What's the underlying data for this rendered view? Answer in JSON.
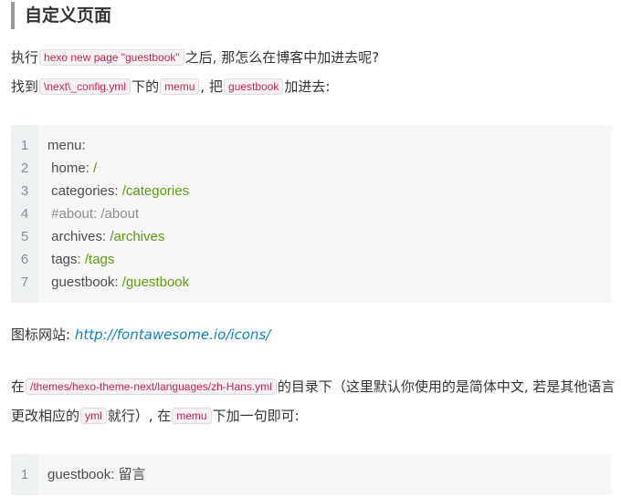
{
  "heading": "自定义页面",
  "p1": {
    "t1": "执行",
    "code1": "hexo new page \"guestbook\"",
    "t2": "之后, 那怎么在博客中加进去呢?"
  },
  "p2": {
    "t1": "找到",
    "code1": "\\next\\_config.yml",
    "t2": "下的",
    "code2": "memu",
    "t3": ", 把",
    "code3": "guestbook",
    "t4": "加进去:"
  },
  "code_block_1": {
    "line_numbers": [
      "1",
      "2",
      "3",
      "4",
      "5",
      "6",
      "7"
    ],
    "lines": [
      {
        "key": "menu:",
        "value": ""
      },
      {
        "key": " home: ",
        "value": "/"
      },
      {
        "key": " categories: ",
        "value": "/categories"
      },
      {
        "comment": " #about: /about"
      },
      {
        "key": " archives: ",
        "value": "/archives"
      },
      {
        "key": " tags: ",
        "value": "/tags"
      },
      {
        "key": " guestbook: ",
        "value": "/guestbook"
      }
    ]
  },
  "p3": {
    "label": "图标网站: ",
    "link": "http://fontawesome.io/icons/"
  },
  "p4": {
    "t1": "在",
    "code1": "/themes/hexo-theme-next/languages/zh-Hans.yml",
    "t2": "的目录下（这里默认你使用的是简体中文, 若是其他语言更改相应的",
    "code2": "yml",
    "t3": "就行）, 在",
    "code3": "memu",
    "t4": "下加一句即可:"
  },
  "code_block_2": {
    "line_numbers": [
      "1"
    ],
    "lines": [
      {
        "key": "guestbook: 留言"
      }
    ]
  },
  "colors": {
    "inline_code_text": "#c7254e",
    "inline_code_bg": "#f9f2f4",
    "link": "#0e83cd",
    "code_value": "#5c9c0f",
    "code_comment": "#8e908c",
    "heading_border": "#999999"
  }
}
